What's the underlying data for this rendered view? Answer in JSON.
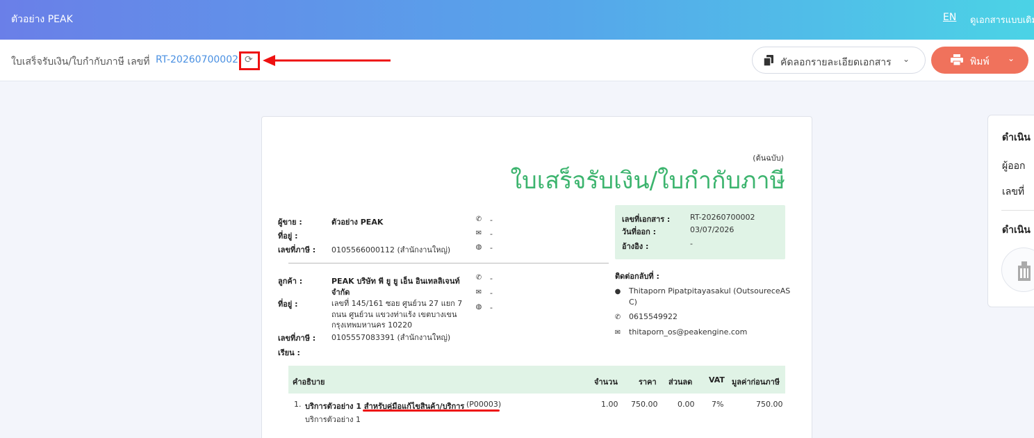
{
  "topbar": {
    "brand": "ตัวอย่าง PEAK",
    "lang": "EN",
    "old_view": "ดูเอกสารแบบเดิม"
  },
  "subbar": {
    "doc_title": "ใบเสร็จรับเงิน/ใบกำกับภาษี เลขที่",
    "doc_no": "RT-20260700002",
    "copy_button": "คัดลอกรายละเอียดเอกสาร",
    "print_button": "พิมพ์"
  },
  "document": {
    "copy_label": "(ต้นฉบับ)",
    "title": "ใบเสร็จรับเงิน/ใบกำกับภาษี",
    "seller": {
      "seller_label": "ผู้ขาย :",
      "seller_value": "ตัวอย่าง PEAK",
      "address_label": "ที่อยู่ :",
      "tax_label": "เลขที่ภาษี :",
      "tax_value": "0105566000112 (สำนักงานใหญ่)",
      "phone": "-",
      "email": "-",
      "web": "-"
    },
    "customer": {
      "customer_label": "ลูกค้า :",
      "customer_line1": "PEAK บริษัท พี ยู ยู เอ็น อินเทลลิเจนท์",
      "customer_line2": "จำกัด",
      "address_label": "ที่อยู่ :",
      "address_line1": "เลขที่ 145/161  ซอย ศูนย์วน 27 แยก 7",
      "address_line2": "ถนน ศูนย์วน  แขวงท่าแร้ง เขตบางเขน",
      "address_line3": "กรุงเทพมหานคร 10220",
      "tax_label": "เลขที่ภาษี :",
      "tax_value": "0105557083391 (สำนักงานใหญ่)",
      "attn_label": "เรียน :",
      "phone": "-",
      "email": "-",
      "web": "-"
    },
    "info": {
      "doc_no_label": "เลขที่เอกสาร :",
      "doc_no_value": "RT-20260700002",
      "issue_label": "วันที่ออก :",
      "issue_value": "03/07/2026",
      "ref_label": "อ้างอิง :",
      "ref_value": "-"
    },
    "contact": {
      "label": "ติดต่อกลับที่ :",
      "name_line1": "Thitaporn Pipatpitayasakul (OutsoureceAS",
      "name_line2": "C)",
      "phone": "0615549922",
      "email": "thitaporn_os@peakengine.com"
    },
    "table": {
      "headers": {
        "desc": "คำอธิบาย",
        "qty": "จำนวน",
        "price": "ราคา",
        "discount": "ส่วนลด",
        "vat": "VAT",
        "pretax": "มูลค่าก่อนภาษี"
      },
      "rows": [
        {
          "no": "1.",
          "name": "บริการตัวอย่าง 1 สำหรับคู่มือแก้ไขสินค้า/บริการ",
          "code": "(P00003)",
          "sub": "บริการตัวอย่าง 1",
          "qty": "1.00",
          "price": "750.00",
          "discount": "0.00",
          "vat": "7%",
          "pretax": "750.00"
        }
      ]
    }
  },
  "sidepanel": {
    "heading1": "ดำเนิน",
    "issuer": "ผู้ออก",
    "number": "เลขที่",
    "heading2": "ดำเนิน"
  }
}
